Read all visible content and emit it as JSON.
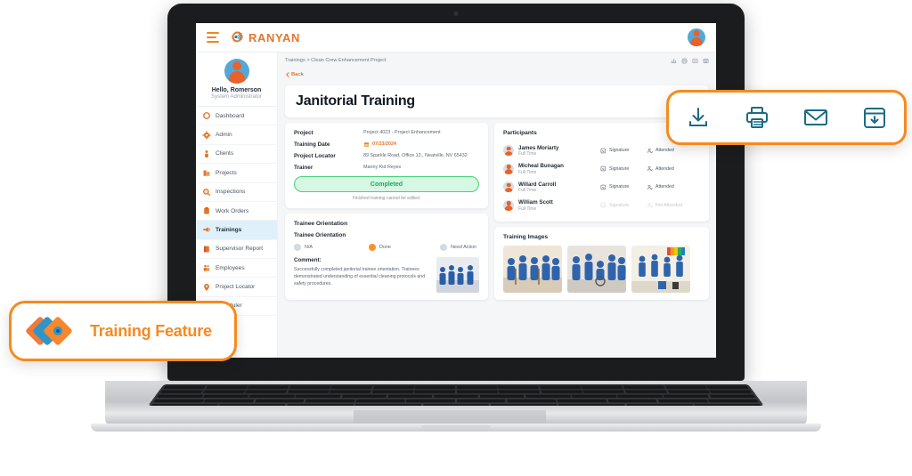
{
  "brand": {
    "name": "RANYAN",
    "logo_icon": "gear-signal-icon",
    "menu_icon": "hamburger-icon",
    "avatar_icon": "user-avatar-icon"
  },
  "sidebar": {
    "greeting": "Hello, Romerson",
    "role": "System Administrator",
    "items": [
      {
        "label": "Dashboard",
        "icon": "dashboard-icon",
        "active": false
      },
      {
        "label": "Admin",
        "icon": "gear-icon",
        "active": false
      },
      {
        "label": "Clients",
        "icon": "person-icon",
        "active": false
      },
      {
        "label": "Projects",
        "icon": "building-icon",
        "active": false
      },
      {
        "label": "Inspections",
        "icon": "magnifier-icon",
        "active": false
      },
      {
        "label": "Work Orders",
        "icon": "clipboard-icon",
        "active": false
      },
      {
        "label": "Trainings",
        "icon": "megaphone-icon",
        "active": true
      },
      {
        "label": "Supervisor Report",
        "icon": "report-icon",
        "active": false
      },
      {
        "label": "Employees",
        "icon": "employees-icon",
        "active": false
      },
      {
        "label": "Project Locator",
        "icon": "map-pin-icon",
        "active": false
      },
      {
        "label": "Scheduler",
        "icon": "calendar-icon",
        "active": false
      }
    ]
  },
  "main": {
    "breadcrumb": "Trainings  >  Clean Crew Enhancement Project",
    "back_label": "Back",
    "page_title": "Janitorial Training",
    "header_icons": [
      "chart-icon",
      "print-icon",
      "note-icon",
      "archive-icon"
    ],
    "details": {
      "fields": [
        {
          "label": "Project",
          "value": "Project 4023 - Project Enhancement"
        },
        {
          "label": "Training Date",
          "value": "07/23/2024",
          "type": "date",
          "icon": "calendar-icon"
        },
        {
          "label": "Project Locator",
          "value": "89 Sparkle Road, Office 12., Neatville, NV 65432"
        },
        {
          "label": "Trainer",
          "value": "Manny Kid Reyes"
        }
      ],
      "status_label": "Completed",
      "status_note": "Finished training cannot be edited."
    },
    "participants": {
      "title": "Participants",
      "rows": [
        {
          "name": "James Moriarty",
          "type": "Full Time",
          "signature": "Signature",
          "attendance": "Attended",
          "muted": false
        },
        {
          "name": "Micheal Bunagan",
          "type": "Full Time",
          "signature": "Signature",
          "attendance": "Attended",
          "muted": false
        },
        {
          "name": "Willard Carroll",
          "type": "Full Time",
          "signature": "Signature",
          "attendance": "Attended",
          "muted": false
        },
        {
          "name": "William Scott",
          "type": "Full Time",
          "signature": "Signature",
          "attendance": "Not Attended",
          "muted": true
        }
      ]
    },
    "orientation": {
      "card_title": "Trainee Orientation",
      "section_title": "Trainee Orientation",
      "options": [
        {
          "label": "N/A",
          "selected": false
        },
        {
          "label": "Done",
          "selected": true
        },
        {
          "label": "Need Action",
          "selected": false
        }
      ],
      "comment_label": "Comment:",
      "comment_text": "Successfully completed janitorial trainee orientation. Trainees demonstrated understanding of essential cleaning protocols and safety procedures."
    },
    "training_images": {
      "title": "Training Images",
      "count": 3
    }
  },
  "float_toolbar": {
    "buttons": [
      {
        "icon": "download-icon",
        "label": "Download"
      },
      {
        "icon": "print-icon",
        "label": "Print"
      },
      {
        "icon": "email-icon",
        "label": "Email"
      },
      {
        "icon": "archive-icon",
        "label": "Archive"
      }
    ]
  },
  "feature_badge": {
    "label": "Training Feature",
    "icon": "diamonds-logo-icon"
  },
  "colors": {
    "accent": "#f68b1f",
    "brand": "#e2762c",
    "blue": "#54a8d8",
    "success": "#1fa95c",
    "success_bg": "#d6f7e2",
    "teal_icon": "#1b6b85",
    "active_nav": "#dff0fb"
  }
}
